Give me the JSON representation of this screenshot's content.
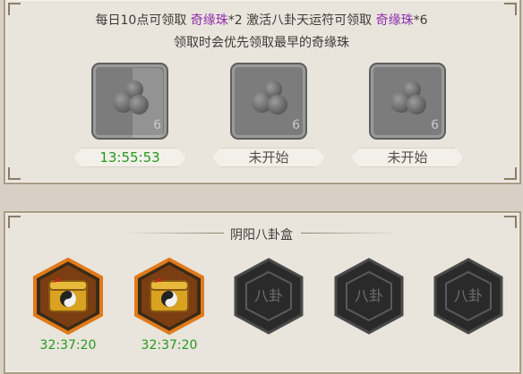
{
  "info": {
    "line1_a": "每日10点可领取 ",
    "line1_hl1": "奇缘珠",
    "line1_b": "*2 激活八卦天运符可领取 ",
    "line1_hl2": "奇缘珠",
    "line1_c": "*6",
    "line2": "领取时会优先领取最早的奇缘珠"
  },
  "slots": [
    {
      "icon": "pearl-icon",
      "qty": "6",
      "label": "13:55:53",
      "label_color": "#239a1f"
    },
    {
      "icon": "pearl-icon",
      "qty": "6",
      "label": "未开始",
      "label_color": "#555049"
    },
    {
      "icon": "pearl-icon",
      "qty": "6",
      "label": "未开始",
      "label_color": "#555049"
    }
  ],
  "box_section": {
    "title": "阴阳八卦盒",
    "boxes": [
      {
        "icon": "yinyang-chest-icon",
        "state": "unlocked",
        "timer": "32:37:20"
      },
      {
        "icon": "yinyang-chest-icon",
        "state": "unlocked",
        "timer": "32:37:20"
      },
      {
        "icon": "bagua-hex-icon",
        "state": "locked",
        "text": "八卦"
      },
      {
        "icon": "bagua-hex-icon",
        "state": "locked",
        "text": "八卦"
      },
      {
        "icon": "bagua-hex-icon",
        "state": "locked",
        "text": "八卦"
      }
    ]
  },
  "colors": {
    "highlight": "#8e2fae",
    "timer": "#239a1f",
    "hex_dark": "#2a2a2a",
    "hex_gold": "#c96a17"
  }
}
